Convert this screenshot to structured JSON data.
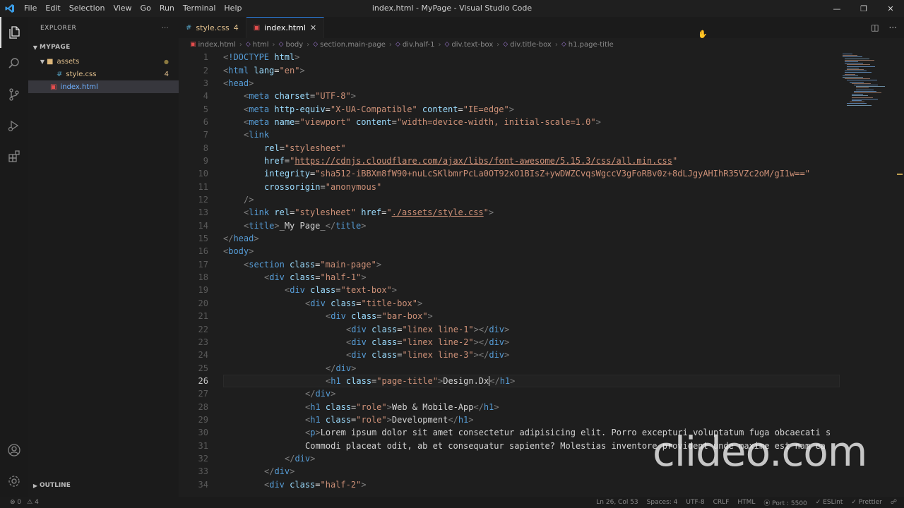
{
  "titlebar": {
    "menu": [
      "File",
      "Edit",
      "Selection",
      "View",
      "Go",
      "Run",
      "Terminal",
      "Help"
    ],
    "window_title": "index.html - MyPage - Visual Studio Code"
  },
  "sidebar": {
    "header": "EXPLORER",
    "header_more": "···",
    "project": "MYPAGE",
    "tree": [
      {
        "label": "assets",
        "badge": "",
        "kind": "folder",
        "color": "#e2c08d"
      },
      {
        "label": "style.css",
        "badge": "4",
        "kind": "css",
        "color": "#e2c08d"
      },
      {
        "label": "index.html",
        "badge": "",
        "kind": "html",
        "color": "#6fb0ff"
      }
    ],
    "outline": "OUTLINE"
  },
  "tabs": [
    {
      "label": "style.css",
      "badge": "4",
      "active": false
    },
    {
      "label": "index.html",
      "badge": "",
      "active": true
    }
  ],
  "breadcrumbs": [
    "index.html",
    "html",
    "body",
    "section.main-page",
    "div.half-1",
    "div.text-box",
    "div.title-box",
    "h1.page-title"
  ],
  "editor": {
    "current_line": 26,
    "line_numbers": [
      "1",
      "2",
      "3",
      "4",
      "5",
      "6",
      "7",
      "8",
      "9",
      "10",
      "11",
      "12",
      "13",
      "14",
      "15",
      "16",
      "17",
      "18",
      "19",
      "20",
      "21",
      "22",
      "23",
      "24",
      "25",
      "26",
      "27",
      "28",
      "29",
      "30",
      "31",
      "32",
      "33",
      "34"
    ]
  },
  "status": {
    "errors": "⊗ 0",
    "warnings": "⚠ 4",
    "position": "Ln 26, Col 53",
    "spaces": "Spaces: 4",
    "encoding": "UTF-8",
    "eol": "CRLF",
    "language": "HTML",
    "port": "⦿ Port : 5500",
    "eslint": "✓ ESLint",
    "prettier": "✓ Prettier"
  },
  "watermark": "clideo.com",
  "colors": {
    "tag": "#569cd6",
    "attribute": "#9cdcfe",
    "string": "#ce9178",
    "accent": "#2b79d6"
  }
}
